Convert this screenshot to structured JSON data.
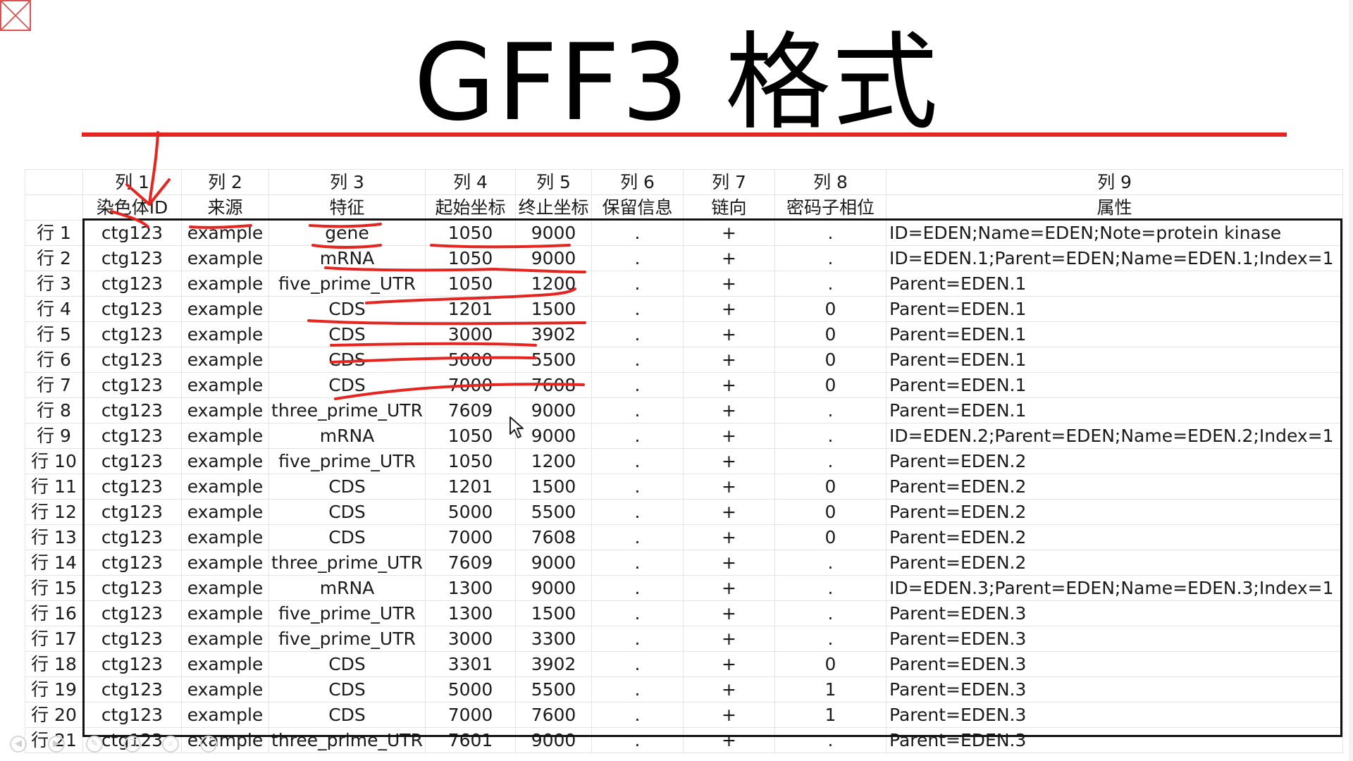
{
  "title": "GFF3 格式",
  "colors": {
    "accent": "#e52620",
    "ink": "#111111"
  },
  "header_row1": [
    "",
    "列 1",
    "列 2",
    "列 3",
    "列 4",
    "列 5",
    "列 6",
    "列 7",
    "列 8",
    "列 9"
  ],
  "header_row2": [
    "",
    "染色体ID",
    "来源",
    "特征",
    "起始坐标",
    "终止坐标",
    "保留信息",
    "链向",
    "密码子相位",
    "属性"
  ],
  "rows": [
    [
      "行 1",
      "ctg123",
      "example",
      "gene",
      "1050",
      "9000",
      ".",
      "+",
      ".",
      "ID=EDEN;Name=EDEN;Note=protein kinase"
    ],
    [
      "行 2",
      "ctg123",
      "example",
      "mRNA",
      "1050",
      "9000",
      ".",
      "+",
      ".",
      "ID=EDEN.1;Parent=EDEN;Name=EDEN.1;Index=1"
    ],
    [
      "行 3",
      "ctg123",
      "example",
      "five_prime_UTR",
      "1050",
      "1200",
      ".",
      "+",
      ".",
      "Parent=EDEN.1"
    ],
    [
      "行 4",
      "ctg123",
      "example",
      "CDS",
      "1201",
      "1500",
      ".",
      "+",
      "0",
      "Parent=EDEN.1"
    ],
    [
      "行 5",
      "ctg123",
      "example",
      "CDS",
      "3000",
      "3902",
      ".",
      "+",
      "0",
      "Parent=EDEN.1"
    ],
    [
      "行 6",
      "ctg123",
      "example",
      "CDS",
      "5000",
      "5500",
      ".",
      "+",
      "0",
      "Parent=EDEN.1"
    ],
    [
      "行 7",
      "ctg123",
      "example",
      "CDS",
      "7000",
      "7608",
      ".",
      "+",
      "0",
      "Parent=EDEN.1"
    ],
    [
      "行 8",
      "ctg123",
      "example",
      "three_prime_UTR",
      "7609",
      "9000",
      ".",
      "+",
      ".",
      "Parent=EDEN.1"
    ],
    [
      "行 9",
      "ctg123",
      "example",
      "mRNA",
      "1050",
      "9000",
      ".",
      "+",
      ".",
      "ID=EDEN.2;Parent=EDEN;Name=EDEN.2;Index=1"
    ],
    [
      "行 10",
      "ctg123",
      "example",
      "five_prime_UTR",
      "1050",
      "1200",
      ".",
      "+",
      ".",
      "Parent=EDEN.2"
    ],
    [
      "行 11",
      "ctg123",
      "example",
      "CDS",
      "1201",
      "1500",
      ".",
      "+",
      "0",
      "Parent=EDEN.2"
    ],
    [
      "行 12",
      "ctg123",
      "example",
      "CDS",
      "5000",
      "5500",
      ".",
      "+",
      "0",
      "Parent=EDEN.2"
    ],
    [
      "行 13",
      "ctg123",
      "example",
      "CDS",
      "7000",
      "7608",
      ".",
      "+",
      "0",
      "Parent=EDEN.2"
    ],
    [
      "行 14",
      "ctg123",
      "example",
      "three_prime_UTR",
      "7609",
      "9000",
      ".",
      "+",
      ".",
      "Parent=EDEN.2"
    ],
    [
      "行 15",
      "ctg123",
      "example",
      "mRNA",
      "1300",
      "9000",
      ".",
      "+",
      ".",
      "ID=EDEN.3;Parent=EDEN;Name=EDEN.3;Index=1"
    ],
    [
      "行 16",
      "ctg123",
      "example",
      "five_prime_UTR",
      "1300",
      "1500",
      ".",
      "+",
      ".",
      "Parent=EDEN.3"
    ],
    [
      "行 17",
      "ctg123",
      "example",
      "five_prime_UTR",
      "3000",
      "3300",
      ".",
      "+",
      ".",
      "Parent=EDEN.3"
    ],
    [
      "行 18",
      "ctg123",
      "example",
      "CDS",
      "3301",
      "3902",
      ".",
      "+",
      "0",
      "Parent=EDEN.3"
    ],
    [
      "行 19",
      "ctg123",
      "example",
      "CDS",
      "5000",
      "5500",
      ".",
      "+",
      "1",
      "Parent=EDEN.3"
    ],
    [
      "行 20",
      "ctg123",
      "example",
      "CDS",
      "7000",
      "7600",
      ".",
      "+",
      "1",
      "Parent=EDEN.3"
    ],
    [
      "行 21",
      "ctg123",
      "example",
      "three_prime_UTR",
      "7601",
      "9000",
      ".",
      "+",
      ".",
      "Parent=EDEN.3"
    ]
  ],
  "icons": {
    "broken_image": "broken-image-icon",
    "cursor": "mouse-pointer-icon",
    "nav": [
      "prev-slide-icon",
      "next-slide-icon",
      "pen-icon",
      "copy-icon",
      "zoom-icon",
      "more-icon"
    ]
  }
}
